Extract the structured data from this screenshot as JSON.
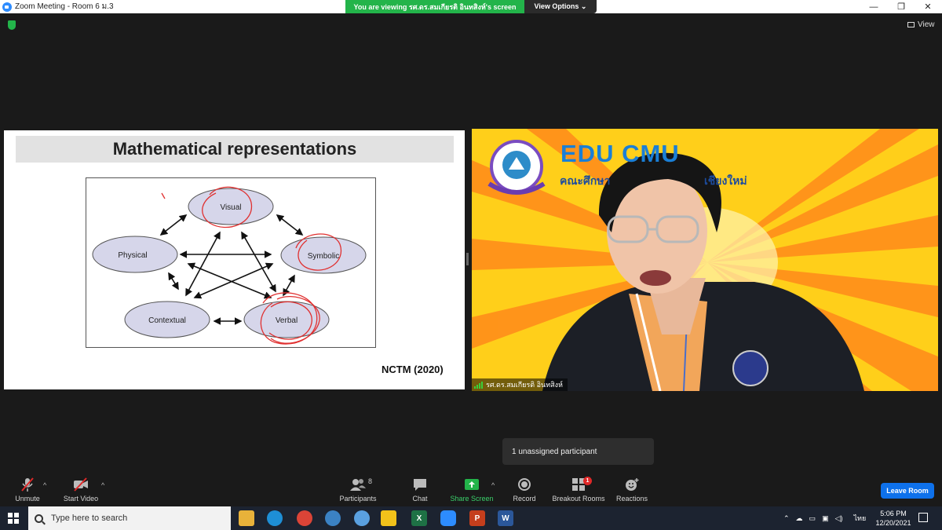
{
  "window": {
    "title": "Zoom Meeting - Room 6 ม.3",
    "viewing_banner": "You are viewing รศ.ดร.สมเกียรติ อินทสิงห์'s screen",
    "view_options": "View Options ⌄",
    "view_button": "View",
    "minimize": "—",
    "restore": "❐",
    "close": "✕"
  },
  "slide": {
    "title": "Mathematical representations",
    "nodes": [
      "Visual",
      "Physical",
      "Symbolic",
      "Contextual",
      "Verbal"
    ],
    "citation": "NCTM (2020)"
  },
  "video": {
    "banner_title": "EDU CMU",
    "banner_sub_left": "คณะศึกษา",
    "banner_sub_right": "เชียงใหม่",
    "participant_name": "รศ.ดร.สมเกียรติ อินทสิงห์"
  },
  "tooltip": "1 unassigned participant",
  "toolbar": {
    "unmute": "Unmute",
    "start_video": "Start Video",
    "participants": "Participants",
    "participants_count": "8",
    "chat": "Chat",
    "share_screen": "Share Screen",
    "record": "Record",
    "breakout_rooms": "Breakout Rooms",
    "breakout_badge": "1",
    "reactions": "Reactions",
    "leave_room": "Leave Room",
    "caret": "^"
  },
  "taskbar": {
    "search_placeholder": "Type here to search",
    "language": "ไทย",
    "time": "5:06 PM",
    "date": "12/20/2021"
  },
  "colors": {
    "share_green": "#23b44a",
    "leave_blue": "#0e71eb",
    "mute_red": "#e02828"
  }
}
